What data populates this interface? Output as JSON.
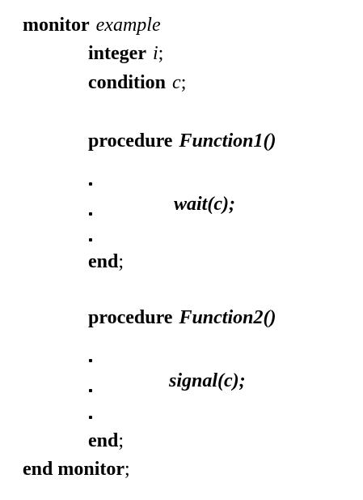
{
  "code": {
    "monitor_kw": "monitor",
    "monitor_name": "example",
    "integer_kw": "integer",
    "integer_var": "i",
    "semicolon": ";",
    "condition_kw": "condition",
    "condition_var": "c",
    "procedure_kw": "procedure",
    "function1": "Function1()",
    "wait_call": "wait(c);",
    "end_kw": "end",
    "function2": "Function2()",
    "signal_call": "signal(c);",
    "end_monitor_kw": "end monitor"
  }
}
